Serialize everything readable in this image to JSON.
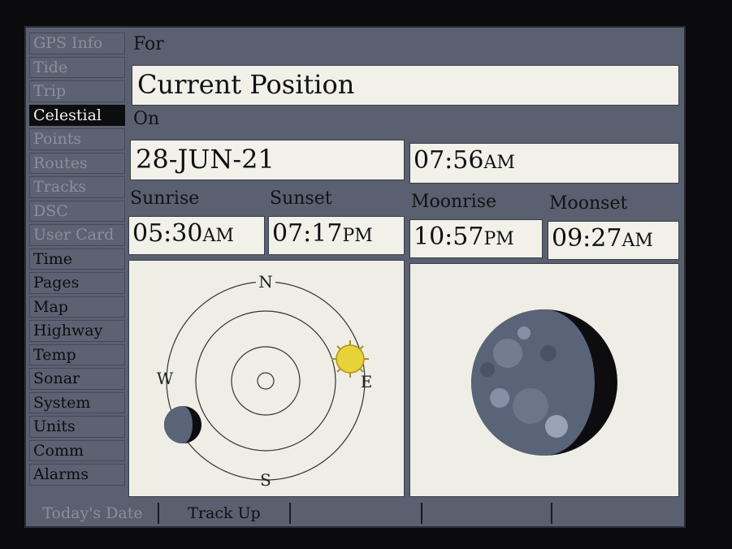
{
  "sidebar": {
    "items": [
      {
        "label": "GPS Info",
        "state": "dim"
      },
      {
        "label": "Tide",
        "state": "dim"
      },
      {
        "label": "Trip",
        "state": "dim"
      },
      {
        "label": "Celestial",
        "state": "active"
      },
      {
        "label": "Points",
        "state": "dim"
      },
      {
        "label": "Routes",
        "state": "dim"
      },
      {
        "label": "Tracks",
        "state": "dim"
      },
      {
        "label": "DSC",
        "state": "dim"
      },
      {
        "label": "User Card",
        "state": "dim"
      },
      {
        "label": "Time",
        "state": "normal"
      },
      {
        "label": "Pages",
        "state": "normal"
      },
      {
        "label": "Map",
        "state": "normal"
      },
      {
        "label": "Highway",
        "state": "normal"
      },
      {
        "label": "Temp",
        "state": "normal"
      },
      {
        "label": "Sonar",
        "state": "normal"
      },
      {
        "label": "System",
        "state": "normal"
      },
      {
        "label": "Units",
        "state": "normal"
      },
      {
        "label": "Comm",
        "state": "normal"
      },
      {
        "label": "Alarms",
        "state": "normal"
      }
    ]
  },
  "main": {
    "for_label": "For",
    "position_value": "Current Position",
    "on_label": "On",
    "date_value": "28-JUN-21",
    "time_value": "07:56",
    "time_ampm": "AM",
    "events": [
      {
        "label": "Sunrise",
        "time": "05:30",
        "ampm": "AM"
      },
      {
        "label": "Sunset",
        "time": "07:17",
        "ampm": "PM"
      },
      {
        "label": "Moonrise",
        "time": "10:57",
        "ampm": "PM"
      },
      {
        "label": "Moonset",
        "time": "09:27",
        "ampm": "AM"
      }
    ],
    "sky_chart": {
      "north": "N",
      "south": "S",
      "east": "E",
      "west": "W"
    }
  },
  "bottom_bar": {
    "todays_date_label": "Today's Date",
    "track_up_label": "Track Up",
    "blank1": "",
    "blank2": "",
    "blank3": ""
  },
  "colors": {
    "screen_bg": "#5a6070",
    "field_bg": "#f1f1ea",
    "sun": "#e8d23a",
    "moon_dark": "#0d0d10",
    "moon_lit": "#5a6478"
  }
}
